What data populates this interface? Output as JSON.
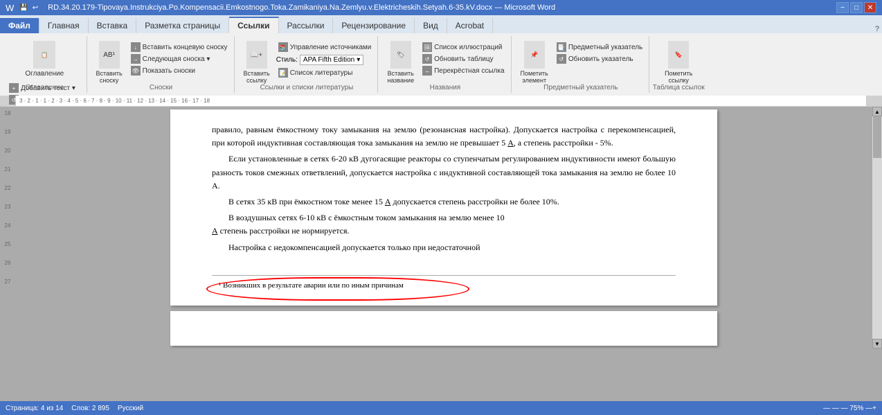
{
  "titleBar": {
    "title": "RD.34.20.179-Tipovaya.Instrukciya.Po.Kompensacii.Emkostnogo.Toka.Zamikaniya.Na.Zemlyu.v.Elektricheskih.Setyah.6-35.kV.docx — Microsoft Word",
    "minimize": "−",
    "maximize": "□",
    "close": "✕"
  },
  "ribbonTabs": [
    {
      "label": "Файл",
      "class": "file"
    },
    {
      "label": "Главная",
      "class": ""
    },
    {
      "label": "Вставка",
      "class": ""
    },
    {
      "label": "Разметка страницы",
      "class": ""
    },
    {
      "label": "Ссылки",
      "class": "active"
    },
    {
      "label": "Рассылки",
      "class": ""
    },
    {
      "label": "Рецензирование",
      "class": ""
    },
    {
      "label": "Вид",
      "class": ""
    },
    {
      "label": "Acrobat",
      "class": ""
    }
  ],
  "groups": {
    "oglav": {
      "label": "Оглавление",
      "btn_label": "Оглавление",
      "items": [
        "Добавить текст ▾",
        "Обновить таблицу"
      ]
    },
    "snoski": {
      "label": "Сноски",
      "items": [
        "Вставить сноску",
        "Вставить концевую сноску",
        "Следующая сноска ▾",
        "Показать сноски"
      ]
    },
    "ssylki": {
      "label": "Ссылки и списки литературы",
      "items": [
        "Вставить ссылку",
        "Стиль:",
        "APA Fifth Edition",
        "Список литературы"
      ]
    },
    "nazvania": {
      "label": "Названия",
      "items": [
        "Вставить название",
        "Список иллюстраций",
        "Обновить таблицу",
        "Перекрёстная ссылка"
      ]
    },
    "predmet": {
      "label": "Предметный указатель",
      "items": [
        "Пометить элемент",
        "Предметный указатель",
        "Обновить указатель"
      ]
    },
    "tablica": {
      "label": "Таблица ссылок",
      "items": [
        "Пометить ссылку"
      ]
    }
  },
  "document": {
    "paragraphs": [
      "правило, равным ёмкостному току замыкания на землю (резонансная настройка). Допускается настройка с перекомпенсацией, при которой индуктивная составляющая тока замыкания на землю не превышает 5 А, а степень расстройки - 5%.",
      "Если установленные в сетях 6-20 кВ дугогасящие реакторы со ступенчатым регулированием индуктивности имеют большую разность токов смежных ответвлений, допускается настройка с индуктивной составляющей тока замыкания на землю не более 10 А.",
      "В сетях 35 кВ при ёмкостном токе менее 15 А допускается степень расстройки не более 10%.",
      "В воздушных сетях 6-10 кВ с ёмкостным током замыкания на землю менее 10 А степень расстройки не нормируется.",
      "Настройка с недокомпенсацией допускается только при недостаточной"
    ],
    "footnote": "¹ Возникших в результате аварии или по иным причинам"
  },
  "statusBar": {
    "page": "Страница: 4 из 14",
    "words": "Слов: 2 895",
    "lang": "Русский"
  }
}
